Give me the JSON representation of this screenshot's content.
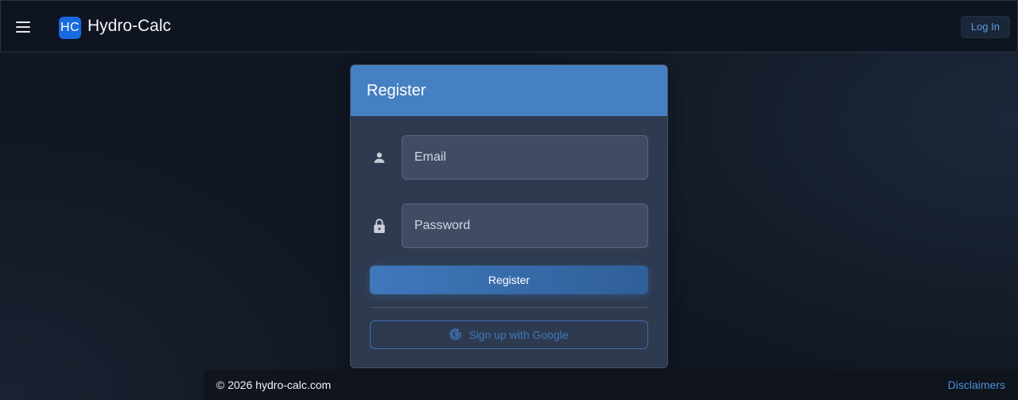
{
  "header": {
    "logo_text": "HC",
    "app_title": "Hydro-Calc",
    "login_label": "Log In",
    "menu_icon": "hamburger-menu-icon"
  },
  "register_form": {
    "title": "Register",
    "email": {
      "placeholder": "Email",
      "value": "",
      "icon": "person-icon"
    },
    "password": {
      "placeholder": "Password",
      "value": "",
      "icon": "lock-icon"
    },
    "submit_label": "Register",
    "google_label": "Sign up with Google",
    "google_icon": "google-g-icon"
  },
  "footer": {
    "copyright": "© 2026 hydro-calc.com",
    "disclaimers_label": "Disclaimers"
  },
  "colors": {
    "accent": "#4580c2",
    "background": "#111722",
    "card": "#2e3a4f",
    "logo": "#1769e0",
    "link": "#4e8fd6"
  }
}
